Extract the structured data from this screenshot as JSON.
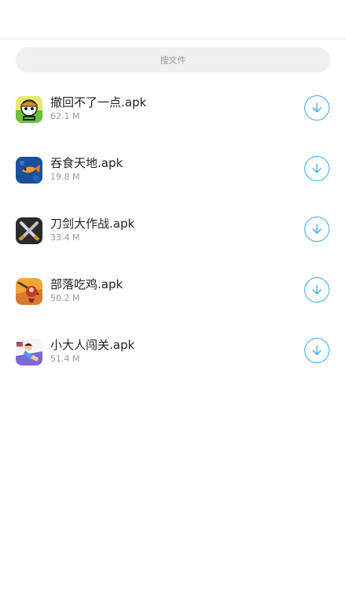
{
  "search": {
    "placeholder": "搜文件"
  },
  "accent_color": "#3aa9f0",
  "files": [
    {
      "name": "撤回不了一点.apk",
      "size": "62.1 M",
      "icon": "app-icon-cartoon-character"
    },
    {
      "name": "吞食天地.apk",
      "size": "19.8 M",
      "icon": "app-icon-goldfish"
    },
    {
      "name": "刀剑大作战.apk",
      "size": "33.4 M",
      "icon": "app-icon-crossed-swords"
    },
    {
      "name": "部落吃鸡.apk",
      "size": "50.2 M",
      "icon": "app-icon-tribe-warrior"
    },
    {
      "name": "小大人闯关.apk",
      "size": "51.4 M",
      "icon": "app-icon-runner-character"
    }
  ],
  "download_icon": "download-arrow-icon"
}
